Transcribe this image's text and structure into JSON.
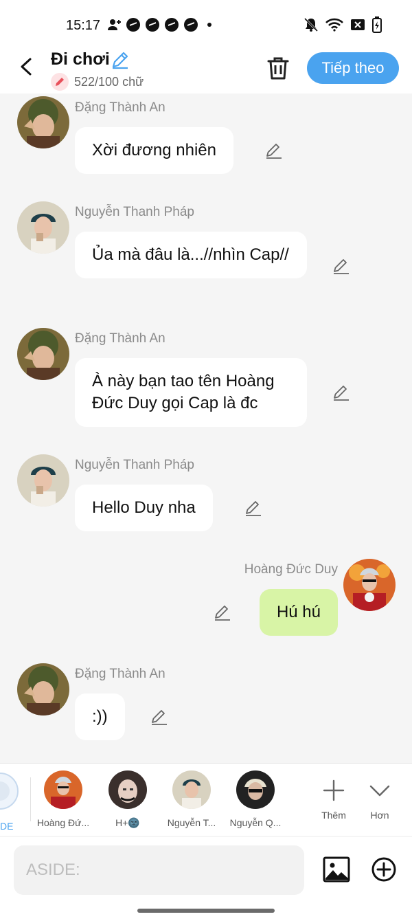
{
  "status_bar": {
    "time": "15:17"
  },
  "header": {
    "title": "Đi chơi",
    "counter": "522/100 chữ",
    "next_label": "Tiếp theo"
  },
  "messages": [
    {
      "sender": "Đặng Thành An",
      "text": "Xời đương nhiên"
    },
    {
      "sender": "Nguyễn Thanh Pháp",
      "text": "Ủa mà đâu là...//nhìn Cap//"
    },
    {
      "sender": "Đặng Thành An",
      "text": "À này bạn tao tên Hoàng Đức Duy gọi Cap là đc"
    },
    {
      "sender": "Nguyễn Thanh Pháp",
      "text": "Hello Duy nha"
    },
    {
      "sender": "Hoàng Đức Duy",
      "text": "Hú hú"
    },
    {
      "sender": "Đặng Thành An",
      "text": ":))"
    }
  ],
  "strip": {
    "partial_label": "DE",
    "contacts": [
      {
        "name": "Hoàng Đứ..."
      },
      {
        "name": "H+🌚"
      },
      {
        "name": "Nguyễn T..."
      },
      {
        "name": "Nguyễn Q..."
      }
    ],
    "more_add_label": "Thêm",
    "more_label": "Hơn"
  },
  "input": {
    "placeholder": "ASIDE:"
  },
  "colors": {
    "accent": "#4aa3ef",
    "my_bubble": "#d8f4a6",
    "bubble": "#ffffff",
    "background": "#f5f5f5"
  }
}
